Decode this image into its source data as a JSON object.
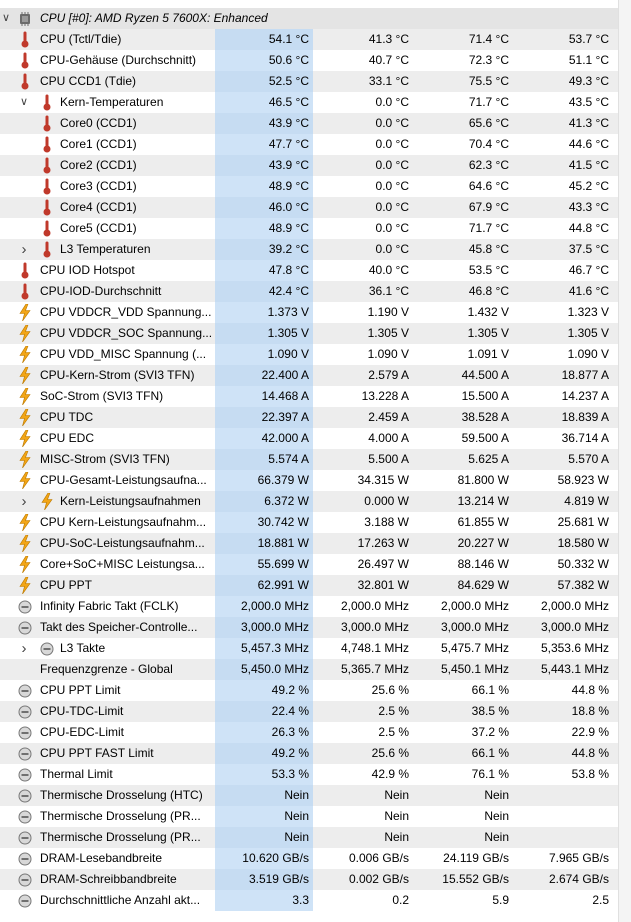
{
  "group": {
    "title": "CPU [#0]: AMD Ryzen 5 7600X: Enhanced",
    "icon": "cpu-chip-icon",
    "expanded": true
  },
  "rows": [
    {
      "label": "CPU (Tctl/Tdie)",
      "icon": "thermometer-icon",
      "indent": 0,
      "values": [
        "54.1 °C",
        "41.3 °C",
        "71.4 °C",
        "53.7 °C"
      ]
    },
    {
      "label": "CPU-Gehäuse (Durchschnitt)",
      "icon": "thermometer-icon",
      "indent": 0,
      "values": [
        "50.6 °C",
        "40.7 °C",
        "72.3 °C",
        "51.1 °C"
      ]
    },
    {
      "label": "CPU CCD1 (Tdie)",
      "icon": "thermometer-icon",
      "indent": 0,
      "values": [
        "52.5 °C",
        "33.1 °C",
        "75.5 °C",
        "49.3 °C"
      ]
    },
    {
      "label": "Kern-Temperaturen",
      "icon": "thermometer-icon",
      "indent": 1,
      "expander": "expanded",
      "values": [
        "46.5 °C",
        "0.0 °C",
        "71.7 °C",
        "43.5 °C"
      ]
    },
    {
      "label": "Core0 (CCD1)",
      "icon": "thermometer-icon",
      "indent": 2,
      "values": [
        "43.9 °C",
        "0.0 °C",
        "65.6 °C",
        "41.3 °C"
      ]
    },
    {
      "label": "Core1 (CCD1)",
      "icon": "thermometer-icon",
      "indent": 2,
      "values": [
        "47.7 °C",
        "0.0 °C",
        "70.4 °C",
        "44.6 °C"
      ]
    },
    {
      "label": "Core2 (CCD1)",
      "icon": "thermometer-icon",
      "indent": 2,
      "values": [
        "43.9 °C",
        "0.0 °C",
        "62.3 °C",
        "41.5 °C"
      ]
    },
    {
      "label": "Core3 (CCD1)",
      "icon": "thermometer-icon",
      "indent": 2,
      "values": [
        "48.9 °C",
        "0.0 °C",
        "64.6 °C",
        "45.2 °C"
      ]
    },
    {
      "label": "Core4 (CCD1)",
      "icon": "thermometer-icon",
      "indent": 2,
      "values": [
        "46.0 °C",
        "0.0 °C",
        "67.9 °C",
        "43.3 °C"
      ]
    },
    {
      "label": "Core5 (CCD1)",
      "icon": "thermometer-icon",
      "indent": 2,
      "values": [
        "48.9 °C",
        "0.0 °C",
        "71.7 °C",
        "44.8 °C"
      ]
    },
    {
      "label": "L3 Temperaturen",
      "icon": "thermometer-icon",
      "indent": 1,
      "expander": "collapsed",
      "values": [
        "39.2 °C",
        "0.0 °C",
        "45.8 °C",
        "37.5 °C"
      ]
    },
    {
      "label": "CPU IOD Hotspot",
      "icon": "thermometer-icon",
      "indent": 0,
      "values": [
        "47.8 °C",
        "40.0 °C",
        "53.5 °C",
        "46.7 °C"
      ]
    },
    {
      "label": "CPU-IOD-Durchschnitt",
      "icon": "thermometer-icon",
      "indent": 0,
      "values": [
        "42.4 °C",
        "36.1 °C",
        "46.8 °C",
        "41.6 °C"
      ]
    },
    {
      "label": "CPU VDDCR_VDD Spannung...",
      "icon": "lightning-icon",
      "indent": 0,
      "values": [
        "1.373 V",
        "1.190 V",
        "1.432 V",
        "1.323 V"
      ]
    },
    {
      "label": "CPU VDDCR_SOC Spannung...",
      "icon": "lightning-icon",
      "indent": 0,
      "values": [
        "1.305 V",
        "1.305 V",
        "1.305 V",
        "1.305 V"
      ]
    },
    {
      "label": "CPU VDD_MISC Spannung (...",
      "icon": "lightning-icon",
      "indent": 0,
      "values": [
        "1.090 V",
        "1.090 V",
        "1.091 V",
        "1.090 V"
      ]
    },
    {
      "label": "CPU-Kern-Strom (SVI3 TFN)",
      "icon": "lightning-icon",
      "indent": 0,
      "values": [
        "22.400 A",
        "2.579 A",
        "44.500 A",
        "18.877 A"
      ]
    },
    {
      "label": "SoC-Strom (SVI3 TFN)",
      "icon": "lightning-icon",
      "indent": 0,
      "values": [
        "14.468 A",
        "13.228 A",
        "15.500 A",
        "14.237 A"
      ]
    },
    {
      "label": "CPU TDC",
      "icon": "lightning-icon",
      "indent": 0,
      "values": [
        "22.397 A",
        "2.459 A",
        "38.528 A",
        "18.839 A"
      ]
    },
    {
      "label": "CPU EDC",
      "icon": "lightning-icon",
      "indent": 0,
      "values": [
        "42.000 A",
        "4.000 A",
        "59.500 A",
        "36.714 A"
      ]
    },
    {
      "label": "MISC-Strom (SVI3 TFN)",
      "icon": "lightning-icon",
      "indent": 0,
      "values": [
        "5.574 A",
        "5.500 A",
        "5.625 A",
        "5.570 A"
      ]
    },
    {
      "label": "CPU-Gesamt-Leistungsaufna...",
      "icon": "lightning-icon",
      "indent": 0,
      "values": [
        "66.379 W",
        "34.315 W",
        "81.800 W",
        "58.923 W"
      ]
    },
    {
      "label": "Kern-Leistungsaufnahmen",
      "icon": "lightning-icon",
      "indent": 1,
      "expander": "collapsed",
      "values": [
        "6.372 W",
        "0.000 W",
        "13.214 W",
        "4.819 W"
      ]
    },
    {
      "label": "CPU Kern-Leistungsaufnahm...",
      "icon": "lightning-icon",
      "indent": 0,
      "values": [
        "30.742 W",
        "3.188 W",
        "61.855 W",
        "25.681 W"
      ]
    },
    {
      "label": "CPU-SoC-Leistungsaufnahm...",
      "icon": "lightning-icon",
      "indent": 0,
      "values": [
        "18.881 W",
        "17.263 W",
        "20.227 W",
        "18.580 W"
      ]
    },
    {
      "label": "Core+SoC+MISC Leistungsa...",
      "icon": "lightning-icon",
      "indent": 0,
      "values": [
        "55.699 W",
        "26.497 W",
        "88.146 W",
        "50.332 W"
      ]
    },
    {
      "label": "CPU PPT",
      "icon": "lightning-icon",
      "indent": 0,
      "values": [
        "62.991 W",
        "32.801 W",
        "84.629 W",
        "57.382 W"
      ]
    },
    {
      "label": "Infinity Fabric Takt (FCLK)",
      "icon": "gauge-icon",
      "indent": 0,
      "values": [
        "2,000.0 MHz",
        "2,000.0 MHz",
        "2,000.0 MHz",
        "2,000.0 MHz"
      ]
    },
    {
      "label": "Takt des Speicher-Controlle...",
      "icon": "gauge-icon",
      "indent": 0,
      "values": [
        "3,000.0 MHz",
        "3,000.0 MHz",
        "3,000.0 MHz",
        "3,000.0 MHz"
      ]
    },
    {
      "label": "L3 Takte",
      "icon": "gauge-icon",
      "indent": 1,
      "expander": "collapsed",
      "values": [
        "5,457.3 MHz",
        "4,748.1 MHz",
        "5,475.7 MHz",
        "5,353.6 MHz"
      ]
    },
    {
      "label": "Frequenzgrenze - Global",
      "icon": "",
      "indent": 0,
      "values": [
        "5,450.0 MHz",
        "5,365.7 MHz",
        "5,450.1 MHz",
        "5,443.1 MHz"
      ]
    },
    {
      "label": "CPU PPT Limit",
      "icon": "gauge-icon",
      "indent": 0,
      "values": [
        "49.2 %",
        "25.6 %",
        "66.1 %",
        "44.8 %"
      ]
    },
    {
      "label": "CPU-TDC-Limit",
      "icon": "gauge-icon",
      "indent": 0,
      "values": [
        "22.4 %",
        "2.5 %",
        "38.5 %",
        "18.8 %"
      ]
    },
    {
      "label": "CPU-EDC-Limit",
      "icon": "gauge-icon",
      "indent": 0,
      "values": [
        "26.3 %",
        "2.5 %",
        "37.2 %",
        "22.9 %"
      ]
    },
    {
      "label": "CPU PPT FAST Limit",
      "icon": "gauge-icon",
      "indent": 0,
      "values": [
        "49.2 %",
        "25.6 %",
        "66.1 %",
        "44.8 %"
      ]
    },
    {
      "label": "Thermal Limit",
      "icon": "gauge-icon",
      "indent": 0,
      "values": [
        "53.3 %",
        "42.9 %",
        "76.1 %",
        "53.8 %"
      ]
    },
    {
      "label": "Thermische Drosselung (HTC)",
      "icon": "gauge-icon",
      "indent": 0,
      "values": [
        "Nein",
        "Nein",
        "Nein",
        ""
      ]
    },
    {
      "label": "Thermische Drosselung (PR...",
      "icon": "gauge-icon",
      "indent": 0,
      "values": [
        "Nein",
        "Nein",
        "Nein",
        ""
      ]
    },
    {
      "label": "Thermische Drosselung (PR...",
      "icon": "gauge-icon",
      "indent": 0,
      "values": [
        "Nein",
        "Nein",
        "Nein",
        ""
      ]
    },
    {
      "label": "DRAM-Lesebandbreite",
      "icon": "gauge-icon",
      "indent": 0,
      "values": [
        "10.620 GB/s",
        "0.006 GB/s",
        "24.119 GB/s",
        "7.965 GB/s"
      ]
    },
    {
      "label": "DRAM-Schreibbandbreite",
      "icon": "gauge-icon",
      "indent": 0,
      "values": [
        "3.519 GB/s",
        "0.002 GB/s",
        "15.552 GB/s",
        "2.674 GB/s"
      ]
    },
    {
      "label": "Durchschnittliche Anzahl akt...",
      "icon": "gauge-icon",
      "indent": 0,
      "values": [
        "3.3",
        "0.2",
        "5.9",
        "2.5"
      ]
    }
  ]
}
